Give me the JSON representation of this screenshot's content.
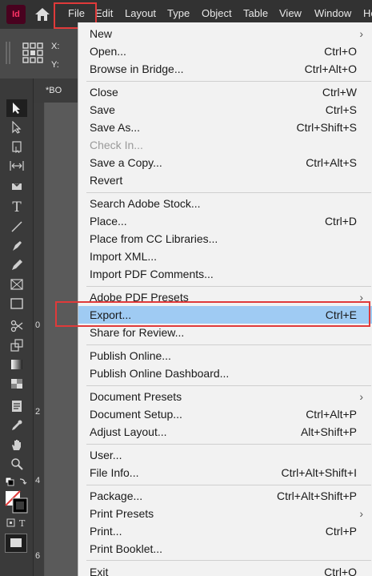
{
  "app": {
    "logo_text": "Id"
  },
  "menubar": {
    "items": [
      "File",
      "Edit",
      "Layout",
      "Type",
      "Object",
      "Table",
      "View",
      "Window",
      "He"
    ]
  },
  "control": {
    "x_label": "X:",
    "y_label": "Y:"
  },
  "document_tab": {
    "label": "*BO"
  },
  "ruler": {
    "marks": [
      "0",
      "2",
      "4",
      "6"
    ]
  },
  "file_menu": {
    "new": {
      "label": "New"
    },
    "open": {
      "label": "Open...",
      "shortcut": "Ctrl+O"
    },
    "browse": {
      "label": "Browse in Bridge...",
      "shortcut": "Ctrl+Alt+O"
    },
    "close": {
      "label": "Close",
      "shortcut": "Ctrl+W"
    },
    "save": {
      "label": "Save",
      "shortcut": "Ctrl+S"
    },
    "save_as": {
      "label": "Save As...",
      "shortcut": "Ctrl+Shift+S"
    },
    "check_in": {
      "label": "Check In..."
    },
    "save_copy": {
      "label": "Save a Copy...",
      "shortcut": "Ctrl+Alt+S"
    },
    "revert": {
      "label": "Revert"
    },
    "search_stock": {
      "label": "Search Adobe Stock..."
    },
    "place": {
      "label": "Place...",
      "shortcut": "Ctrl+D"
    },
    "place_cc": {
      "label": "Place from CC Libraries..."
    },
    "import_xml": {
      "label": "Import XML..."
    },
    "import_pdf_comments": {
      "label": "Import PDF Comments..."
    },
    "pdf_presets": {
      "label": "Adobe PDF Presets"
    },
    "export": {
      "label": "Export...",
      "shortcut": "Ctrl+E"
    },
    "share_review": {
      "label": "Share for Review..."
    },
    "publish_online": {
      "label": "Publish Online..."
    },
    "publish_dashboard": {
      "label": "Publish Online Dashboard..."
    },
    "doc_presets": {
      "label": "Document Presets"
    },
    "doc_setup": {
      "label": "Document Setup...",
      "shortcut": "Ctrl+Alt+P"
    },
    "adjust_layout": {
      "label": "Adjust Layout...",
      "shortcut": "Alt+Shift+P"
    },
    "user": {
      "label": "User..."
    },
    "file_info": {
      "label": "File Info...",
      "shortcut": "Ctrl+Alt+Shift+I"
    },
    "package": {
      "label": "Package...",
      "shortcut": "Ctrl+Alt+Shift+P"
    },
    "print_presets": {
      "label": "Print Presets"
    },
    "print": {
      "label": "Print...",
      "shortcut": "Ctrl+P"
    },
    "print_booklet": {
      "label": "Print Booklet..."
    },
    "exit": {
      "label": "Exit",
      "shortcut": "Ctrl+Q"
    }
  },
  "colors": {
    "highlight": "#9fcbf3",
    "annotation_red": "#e03a3a",
    "indesign_pink": "#ff3366"
  }
}
